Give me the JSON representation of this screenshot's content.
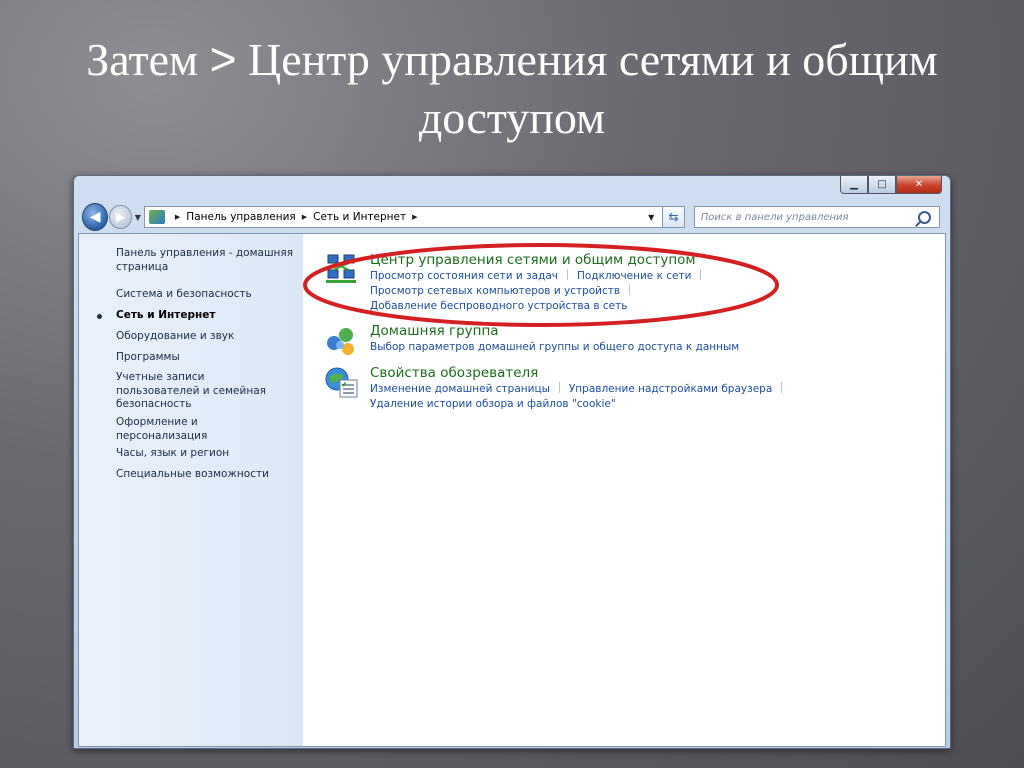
{
  "slide": {
    "title_line1_prefix": "Затем",
    "title_arrow": ">",
    "title_line1_rest": "Центр управления сетями и общим",
    "title_line2": "доступом"
  },
  "window": {
    "controls": {
      "minimize": "▁",
      "maximize": "□",
      "close": "✕"
    }
  },
  "address_bar": {
    "crumbs": [
      "Панель управления",
      "Сеть и Интернет"
    ],
    "search_placeholder": "Поиск в панели управления"
  },
  "sidebar": {
    "home_link": "Панель управления - домашняя страница",
    "items": [
      "Система и безопасность",
      "Сеть и Интернет",
      "Оборудование и звук",
      "Программы",
      "Учетные записи пользователей и семейная безопасность",
      "Оформление и персонализация",
      "Часы, язык и регион",
      "Специальные возможности"
    ],
    "active_index": 1
  },
  "categories": [
    {
      "icon": "network-center-icon",
      "title": "Центр управления сетями и общим доступом",
      "links": [
        [
          "Просмотр состояния сети и задач",
          "Подключение к сети"
        ],
        [
          "Просмотр сетевых компьютеров и устройств"
        ],
        [
          "Добавление беспроводного устройства в сеть"
        ]
      ]
    },
    {
      "icon": "homegroup-icon",
      "title": "Домашняя группа",
      "links": [
        [
          "Выбор параметров домашней группы и общего доступа к данным"
        ]
      ]
    },
    {
      "icon": "internet-options-icon",
      "title": "Свойства обозревателя",
      "links": [
        [
          "Изменение домашней страницы",
          "Управление надстройками браузера"
        ],
        [
          "Удаление истории обзора и файлов \"cookie\""
        ]
      ]
    }
  ],
  "colors": {
    "highlight_ellipse": "#d42020",
    "category_title": "#1c6e1c",
    "link": "#1b4fa0"
  }
}
